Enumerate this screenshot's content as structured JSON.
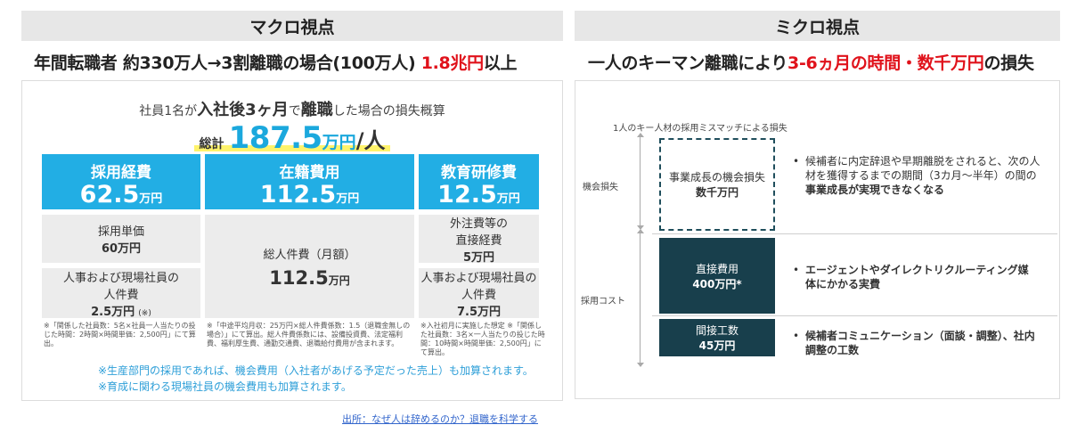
{
  "left": {
    "header": "マクロ視点",
    "headline_main": "年間転職者 約330万人→3割離職の場合(100万人)",
    "headline_amount": "1.8兆円",
    "headline_tail": "以上",
    "summary": {
      "p1": "社員1名が",
      "b1": "入社後3ヶ月",
      "p2": "で",
      "b2": "離職",
      "p3": "した場合の損失概算"
    },
    "total": {
      "prefix": "総計",
      "amount": "187.5",
      "unit": "万円",
      "suffix": "/人"
    },
    "boxes": [
      {
        "label": "採用経費",
        "value": "62.5",
        "unit": "万円"
      },
      {
        "label": "在籍費用",
        "value": "112.5",
        "unit": "万円"
      },
      {
        "label": "教育研修費",
        "value": "12.5",
        "unit": "万円"
      }
    ],
    "hire_unit": {
      "label": "採用単価",
      "value": "60万円"
    },
    "hire_cost": {
      "label1": "人事および現場社員の",
      "label2": "人件費",
      "value": "2.5万円",
      "mark": "(※)"
    },
    "stay": {
      "label": "総人件費（月額）",
      "value": "112.5",
      "unit": "万円"
    },
    "edu_ext": {
      "label1": "外注費等の",
      "label2": "直接経費",
      "value": "5万円"
    },
    "edu_cost": {
      "label1": "人事および現場社員の",
      "label2": "人件費",
      "value": "7.5万円"
    },
    "notes": [
      "※「関係した社員数：5名×社員一人当たりの投じた時間：2時間×時間単価：2,500円」にて算出。",
      "※「中途平均月収：25万円×総人件費係数：1.5（退職金無しの場合）」にて算出。総人件費係数には、設備投資費、法定福利費、福利厚生費、通勤交通費、退職給付費用が含まれます。",
      "※入社初月に実施した想定 ※「関係した社員数：3名×一人当たりの投じた時間：10時間×時間単価：2,500円」にて算出。"
    ],
    "footnotes": [
      "※生産部門の採用であれば、機会費用（入社者があげる予定だった売上）も加算されます。",
      "※育成に関わる現場社員の機会費用も加算されます。"
    ],
    "source": "出所：なぜ人は辞めるのか？退職を科学する"
  },
  "right": {
    "header": "ミクロ視点",
    "headline_main": "一人のキーマン離職により",
    "headline_red": "3-6ヵ月の時間・数千万円",
    "headline_tail": "の損失",
    "diagram_title": "1人のキー人材の採用ミスマッチによる損失",
    "axis_labels": {
      "opportunity": "機会損失",
      "hiring": "採用コスト"
    },
    "dash_box": {
      "label": "事業成長の機会損失",
      "value": "数千万円"
    },
    "direct": {
      "label": "直接費用",
      "value": "400万円*"
    },
    "indirect": {
      "label": "間接工数",
      "value": "45万円"
    },
    "bullets": [
      {
        "normal": "候補者に内定辞退や早期離脱をされると、次の人材を獲得するまでの期間（3カ月〜半年）の間の",
        "bold": "事業成長が実現できなくなる"
      },
      {
        "normal": "",
        "bold": "エージェントやダイレクトリクルーティング媒体にかかる実費"
      },
      {
        "normal": "",
        "bold": "候補者コミュニケーション（面談・調整）、社内調整の工数"
      }
    ]
  }
}
